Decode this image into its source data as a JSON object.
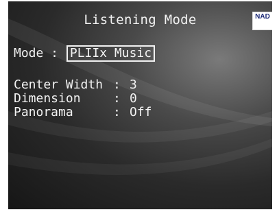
{
  "header": {
    "title": "Listening Mode",
    "logo_text": "NAD"
  },
  "mode": {
    "label": "Mode :",
    "value": "PLIIx Music"
  },
  "settings": [
    {
      "label": "Center Width",
      "separator": ":",
      "value": "3"
    },
    {
      "label": "Dimension",
      "separator": ":",
      "value": "0"
    },
    {
      "label": "Panorama",
      "separator": ":",
      "value": "Off"
    }
  ],
  "colors": {
    "text": "#f2f2f2",
    "background": "#2a2a2a",
    "logo_text": "#1c2a78"
  }
}
